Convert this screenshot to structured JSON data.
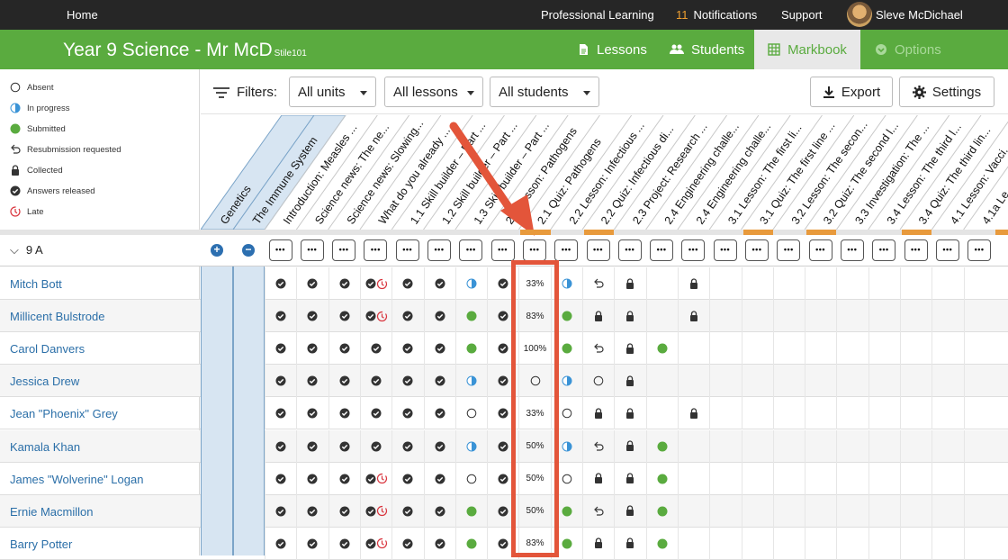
{
  "topbar": {
    "home": "Home",
    "professional_learning": "Professional Learning",
    "notifications_count": "11",
    "notifications_label": "Notifications",
    "support": "Support",
    "user_name": "Sleve McDichael"
  },
  "header": {
    "class_title": "Year 9 Science - Mr McD",
    "class_code": "Stile101",
    "tabs": [
      {
        "label": "Lessons",
        "icon": "document-icon"
      },
      {
        "label": "Students",
        "icon": "people-icon"
      },
      {
        "label": "Markbook",
        "icon": "grid-icon",
        "active": true
      },
      {
        "label": "Options",
        "icon": "chevron-circle-icon",
        "disabled": true
      }
    ]
  },
  "legend": [
    {
      "label": "Absent",
      "icon": "empty-circle-icon"
    },
    {
      "label": "In progress",
      "icon": "half-circle-icon"
    },
    {
      "label": "Submitted",
      "icon": "green-dot-icon"
    },
    {
      "label": "Resubmission requested",
      "icon": "undo-arrow-icon"
    },
    {
      "label": "Collected",
      "icon": "lock-icon"
    },
    {
      "label": "Answers released",
      "icon": "check-circle-icon"
    },
    {
      "label": "Late",
      "icon": "clock-icon"
    }
  ],
  "filters": {
    "label": "Filters:",
    "units": "All units",
    "lessons": "All lessons",
    "students": "All students",
    "export": "Export",
    "settings": "Settings"
  },
  "units": [
    "Genetics",
    "The Immune System"
  ],
  "lessons": [
    "Introduction: Measles ...",
    "Science news: The ne...",
    "Science news: Slowing...",
    "What do you already ...",
    "1.1 Skill builder – Part ...",
    "1.2 Skill builder – Part ...",
    "1.3 Skill builder – Part ...",
    "2.1 Lesson: Pathogens",
    "2.1 Quiz: Pathogens",
    "2.2 Lesson: Infectious ...",
    "2.2 Quiz: Infectious di...",
    "2.3 Project: Research ...",
    "2.4 Engineering challe...",
    "2.4 Engineering challe...",
    "3.1 Lesson: The first li...",
    "3.1 Quiz: The first line ...",
    "3.2 Lesson: The secon...",
    "3.2 Quiz: The second l...",
    "3.3 Investigation: The ...",
    "3.4 Lesson: The third l...",
    "3.4 Quiz: The third lin...",
    "4.1 Lesson: Vacci...",
    "4.1a Le..."
  ],
  "group": {
    "name": "9 A",
    "dots": "•••"
  },
  "students": [
    {
      "name": "Mitch Bott",
      "cells": [
        "check",
        "check",
        "check",
        "check+late",
        "check",
        "check",
        "half",
        "check",
        "33%",
        "half",
        "undo",
        "lock",
        "",
        "lock"
      ]
    },
    {
      "name": "Millicent Bulstrode",
      "cells": [
        "check",
        "check",
        "check",
        "check+late",
        "check",
        "check",
        "green",
        "check",
        "83%",
        "green",
        "lock",
        "lock",
        "",
        "lock"
      ]
    },
    {
      "name": "Carol Danvers",
      "cells": [
        "check",
        "check",
        "check",
        "check",
        "check",
        "check",
        "green",
        "check",
        "100%",
        "green",
        "undo",
        "lock",
        "green",
        ""
      ]
    },
    {
      "name": "Jessica Drew",
      "cells": [
        "check",
        "check",
        "check",
        "check",
        "check",
        "check",
        "half",
        "check",
        "empty",
        "half",
        "empty",
        "lock",
        "",
        ""
      ]
    },
    {
      "name": "Jean \"Phoenix\" Grey",
      "cells": [
        "check",
        "check",
        "check",
        "check",
        "check",
        "check",
        "empty",
        "check",
        "33%",
        "empty",
        "lock",
        "lock",
        "",
        "lock"
      ]
    },
    {
      "name": "Kamala Khan",
      "cells": [
        "check",
        "check",
        "check",
        "check",
        "check",
        "check",
        "half",
        "check",
        "50%",
        "half",
        "undo",
        "lock",
        "green",
        ""
      ]
    },
    {
      "name": "James \"Wolverine\" Logan",
      "cells": [
        "check",
        "check",
        "check",
        "check+late",
        "check",
        "check",
        "empty",
        "check",
        "50%",
        "empty",
        "lock",
        "lock",
        "green",
        ""
      ]
    },
    {
      "name": "Ernie Macmillon",
      "cells": [
        "check",
        "check",
        "check",
        "check+late",
        "check",
        "check",
        "green",
        "check",
        "50%",
        "green",
        "undo",
        "lock",
        "green",
        ""
      ]
    },
    {
      "name": "Barry Potter",
      "cells": [
        "check",
        "check",
        "check",
        "check+late",
        "check",
        "check",
        "green",
        "check",
        "83%",
        "green",
        "lock",
        "lock",
        "green",
        ""
      ]
    }
  ],
  "colors": {
    "topbar": "#262626",
    "green": "#5aab3f",
    "accent_orange": "#e89a3c",
    "highlight_red": "#e3553a",
    "link_blue": "#2b6fa8"
  }
}
